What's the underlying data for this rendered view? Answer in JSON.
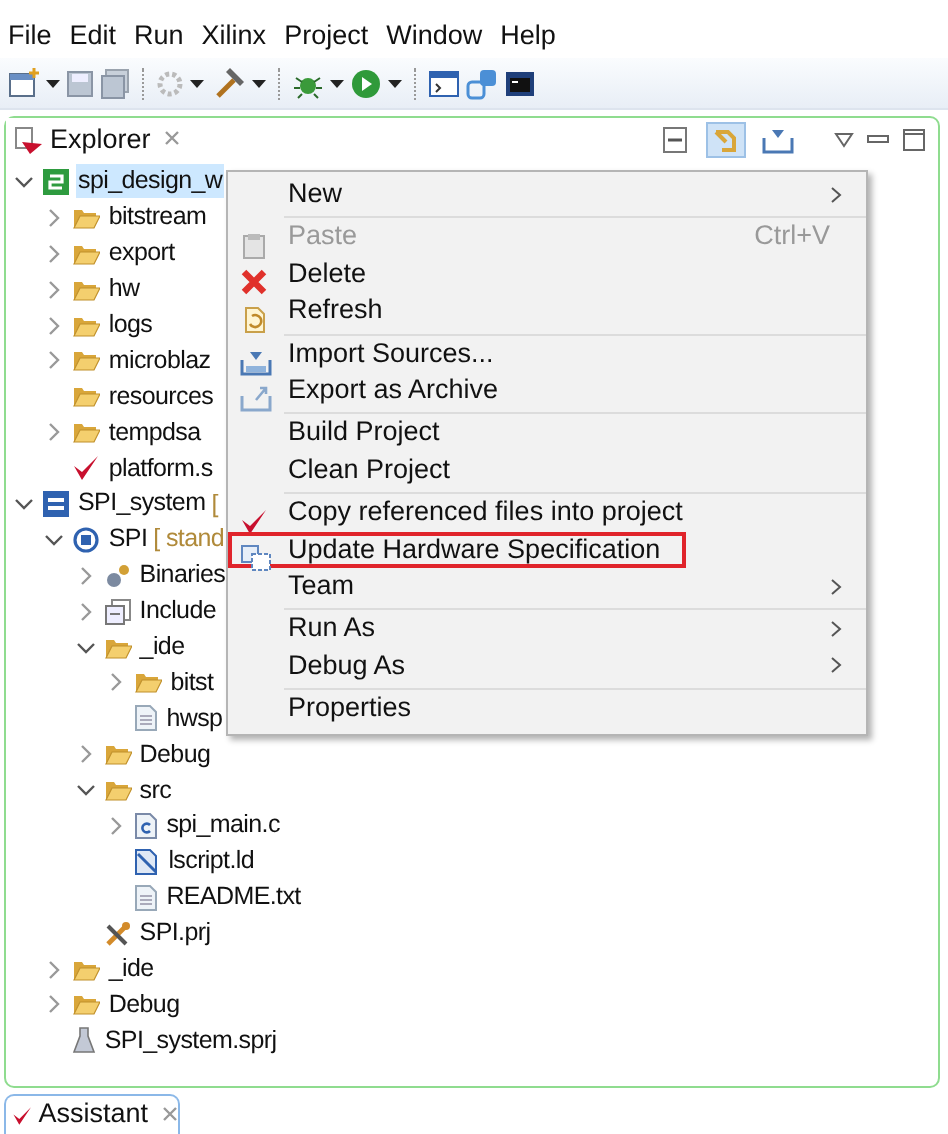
{
  "menu_bar": [
    "File",
    "Edit",
    "Run",
    "Xilinx",
    "Project",
    "Window",
    "Help"
  ],
  "explorer": {
    "title": "Explorer",
    "link_with_editor": {
      "on": true
    },
    "tree": [
      {
        "label": "spi_design_w",
        "kind": "platform-project",
        "expanded": true,
        "selected": true,
        "children": [
          {
            "label": "bitstream",
            "kind": "folder",
            "expanded": false,
            "selected": false
          },
          {
            "label": "export",
            "kind": "folder",
            "expanded": false,
            "selected": false
          },
          {
            "label": "hw",
            "kind": "folder",
            "expanded": false,
            "selected": false
          },
          {
            "label": "logs",
            "kind": "folder",
            "expanded": false,
            "selected": false
          },
          {
            "label": "microblaz",
            "kind": "folder",
            "expanded": false,
            "selected": false
          },
          {
            "label": "resources",
            "kind": "folder",
            "selected": false
          },
          {
            "label": "tempdsa",
            "kind": "folder",
            "expanded": false,
            "selected": false
          },
          {
            "label": "platform.s",
            "kind": "check",
            "selected": false
          }
        ]
      },
      {
        "label": "SPI_system",
        "decoration": "[",
        "kind": "system",
        "expanded": true,
        "selected": false,
        "children": [
          {
            "label": "SPI",
            "decoration": "[ stand",
            "kind": "app",
            "expanded": true,
            "selected": false,
            "children": [
              {
                "label": "Binaries",
                "kind": "binaries",
                "expanded": false,
                "selected": false
              },
              {
                "label": "Include",
                "kind": "includes",
                "expanded": false,
                "selected": false
              },
              {
                "label": "_ide",
                "kind": "folder",
                "expanded": true,
                "selected": false,
                "children": [
                  {
                    "label": "bitst",
                    "kind": "folder",
                    "expanded": false,
                    "selected": false
                  },
                  {
                    "label": "hwsp",
                    "kind": "file",
                    "selected": false
                  }
                ]
              },
              {
                "label": "Debug",
                "kind": "folder",
                "expanded": false,
                "selected": false
              },
              {
                "label": "src",
                "kind": "folder",
                "expanded": true,
                "selected": false,
                "children": [
                  {
                    "label": "spi_main.c",
                    "kind": "c-file",
                    "expanded": false,
                    "selected": false
                  },
                  {
                    "label": "lscript.ld",
                    "kind": "linker",
                    "selected": false
                  },
                  {
                    "label": "README.txt",
                    "kind": "file",
                    "selected": false
                  }
                ]
              },
              {
                "label": "SPI.prj",
                "kind": "tools",
                "selected": false
              }
            ]
          },
          {
            "label": "_ide",
            "kind": "folder",
            "expanded": false,
            "selected": false
          },
          {
            "label": "Debug",
            "kind": "folder",
            "expanded": false,
            "selected": false
          },
          {
            "label": "SPI_system.sprj",
            "kind": "flask",
            "selected": false
          }
        ]
      }
    ]
  },
  "context_menu": [
    [
      {
        "label": "New",
        "submenu": true
      }
    ],
    [
      {
        "label": "Paste",
        "shortcut": "Ctrl+V",
        "kind": "paste",
        "disabled": true
      },
      {
        "label": "Delete",
        "kind": "delete"
      },
      {
        "label": "Refresh",
        "kind": "refresh"
      }
    ],
    [
      {
        "label": "Import Sources...",
        "kind": "import"
      },
      {
        "label": "Export as Archive",
        "kind": "export"
      }
    ],
    [
      {
        "label": "Build Project"
      },
      {
        "label": "Clean Project"
      }
    ],
    [
      {
        "label": "Copy referenced files into project",
        "kind": "check"
      },
      {
        "label": "Update Hardware Specification",
        "kind": "update",
        "highlighted": true
      },
      {
        "label": "Team",
        "submenu": true
      }
    ],
    [
      {
        "label": "Run As",
        "submenu": true
      },
      {
        "label": "Debug As",
        "submenu": true
      }
    ],
    [
      {
        "label": "Properties"
      }
    ]
  ],
  "bottom_panel": {
    "title": "Assistant"
  }
}
